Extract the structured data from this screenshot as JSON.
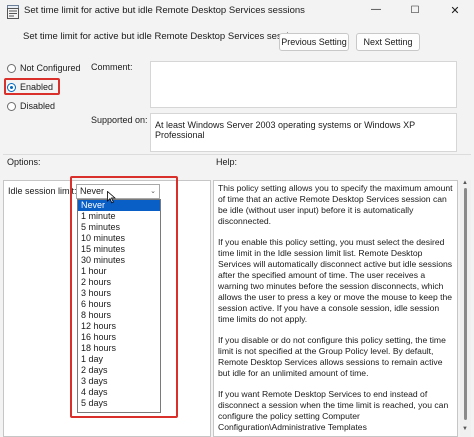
{
  "window": {
    "title": "Set time limit for active but idle Remote Desktop Services sessions",
    "minimize_glyph": "—",
    "maximize_glyph": "☐",
    "close_glyph": "✕"
  },
  "header": {
    "setting_title": "Set time limit for active but idle Remote Desktop Services sessions",
    "prev_label": "Previous Setting",
    "next_label": "Next Setting"
  },
  "state": {
    "not_configured": "Not Configured",
    "enabled": "Enabled",
    "disabled": "Disabled",
    "selected": "Enabled"
  },
  "fields": {
    "comment_label": "Comment:",
    "comment_value": "",
    "supported_label": "Supported on:",
    "supported_value": "At least Windows Server 2003 operating systems or Windows XP Professional"
  },
  "sections": {
    "options_label": "Options:",
    "help_label": "Help:"
  },
  "options": {
    "idle_label": "Idle session limit:",
    "selected_value": "Never",
    "dropdown_items": [
      "Never",
      "1 minute",
      "5 minutes",
      "10 minutes",
      "15 minutes",
      "30 minutes",
      "1 hour",
      "2 hours",
      "3 hours",
      "6 hours",
      "8 hours",
      "12 hours",
      "16 hours",
      "18 hours",
      "1 day",
      "2 days",
      "3 days",
      "4 days",
      "5 days"
    ]
  },
  "help": {
    "paragraphs": [
      "This policy setting allows you to specify the maximum amount of time that an active Remote Desktop Services session can be idle (without user input) before it is automatically disconnected.",
      "If you enable this policy setting, you must select the desired time limit in the Idle session limit list. Remote Desktop Services will automatically disconnect active but idle sessions after the specified amount of time. The user receives a warning two minutes before the session disconnects, which allows the user to press a key or move the mouse to keep the session active. If you have a console session, idle session time limits do not apply.",
      "If you disable or do not configure this policy setting, the time limit is not specified at the Group Policy level. By default,  Remote Desktop Services allows sessions to remain active but idle for an unlimited amount of time.",
      "If you want Remote Desktop Services to end instead of disconnect a session when the time limit is reached, you can configure the policy setting Computer Configuration\\Administrative Templates"
    ]
  },
  "colors": {
    "accent": "#0067c0",
    "highlight_red": "#d9302c",
    "selection": "#0a5fc7"
  }
}
